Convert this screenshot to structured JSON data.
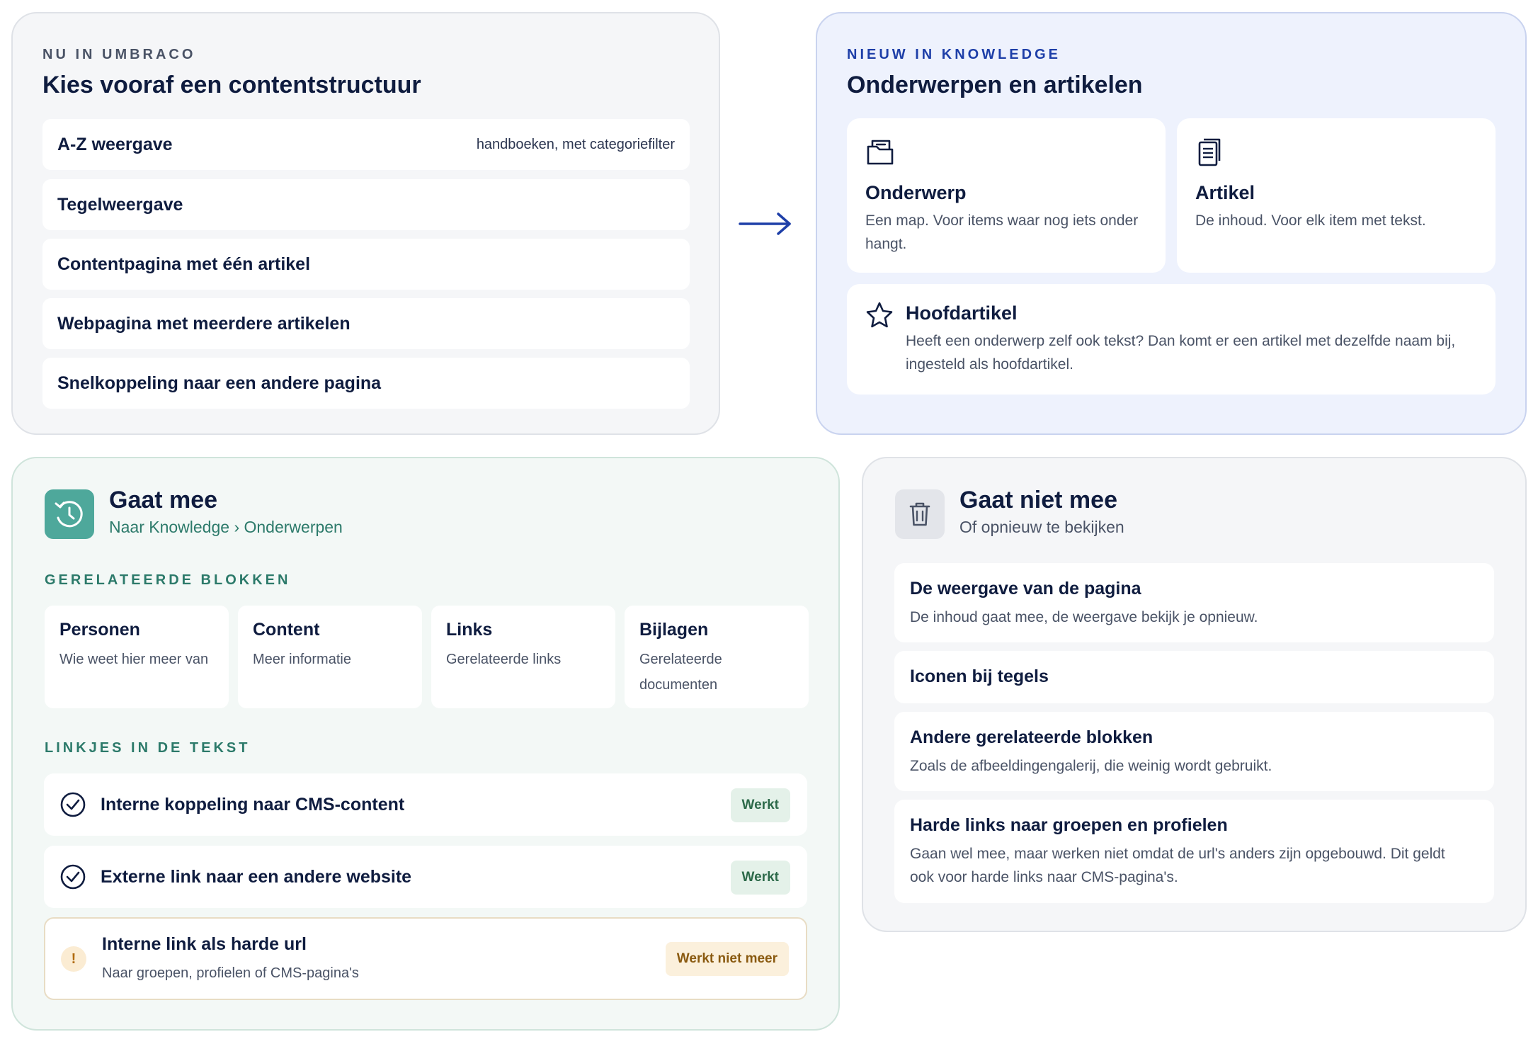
{
  "current": {
    "eyebrow": "NU IN UMBRACO",
    "title": "Kies vooraf een contentstructuur",
    "rows": [
      {
        "label": "A-Z weergave",
        "hint": "handboeken, met categoriefilter"
      },
      {
        "label": "Tegelweergave",
        "hint": ""
      },
      {
        "label": "Contentpagina met één artikel",
        "hint": ""
      },
      {
        "label": "Webpagina met meerdere artikelen",
        "hint": ""
      },
      {
        "label": "Snelkoppeling naar een andere pagina",
        "hint": ""
      }
    ]
  },
  "arrow_icon": "arrow-right-icon",
  "knowledge": {
    "eyebrow": "NIEUW IN KNOWLEDGE",
    "title": "Onderwerpen en artikelen",
    "tiles": [
      {
        "icon": "folder-icon",
        "title": "Onderwerp",
        "desc": "Een map. Voor items waar nog iets onder hangt."
      },
      {
        "icon": "document-icon",
        "title": "Artikel",
        "desc": "De inhoud. Voor elk item met tekst."
      }
    ],
    "main_tile": {
      "icon": "star-icon",
      "title": "Hoofdartikel",
      "desc": "Heeft een onderwerp zelf ook tekst? Dan komt er een artikel met dezelfde naam bij, ingesteld als hoofdartikel."
    }
  },
  "goes": {
    "icon": "history-icon",
    "title": "Gaat mee",
    "subtitle": "Naar Knowledge › Onderwerpen",
    "blocks_heading": "GERELATEERDE BLOKKEN",
    "blocks": [
      {
        "title": "Personen",
        "desc": "Wie weet hier meer van"
      },
      {
        "title": "Content",
        "desc": "Meer informatie"
      },
      {
        "title": "Links",
        "desc": "Gerelateerde links"
      },
      {
        "title": "Bijlagen",
        "desc": "Gerelateerde documenten"
      }
    ],
    "links_heading": "LINKJES IN DE TEKST",
    "links": [
      {
        "label": "Interne koppeling naar CMS-content",
        "status": "Werkt"
      },
      {
        "label": "Externe link naar een andere website",
        "status": "Werkt"
      }
    ],
    "warning": {
      "icon": "!",
      "label": "Interne link als harde url",
      "desc": "Naar groepen, profielen of CMS-pagina's",
      "status": "Werkt niet meer"
    }
  },
  "not_going": {
    "icon": "trash-icon",
    "title": "Gaat niet mee",
    "subtitle": "Of opnieuw te bekijken",
    "items": [
      {
        "title": "De weergave van de pagina",
        "desc": "De inhoud gaat mee, de weergave bekijk je opnieuw."
      },
      {
        "title": "Iconen bij tegels",
        "desc": ""
      },
      {
        "title": "Andere gerelateerde blokken",
        "desc": "Zoals de afbeeldingengalerij, die weinig wordt gebruikt."
      },
      {
        "title": "Harde links naar groepen en profielen",
        "desc": "Gaan wel mee, maar werken niet omdat de url's anders zijn opgebouwd. Dit geldt ook voor harde links naar CMS-pagina's."
      }
    ]
  },
  "colors": {
    "navy": "#0f1c3f",
    "blue_accent": "#1e3fa8",
    "green_accent": "#2c7a6a",
    "teal_icon_bg": "#4ea89b",
    "warning": "#b06a0e"
  }
}
